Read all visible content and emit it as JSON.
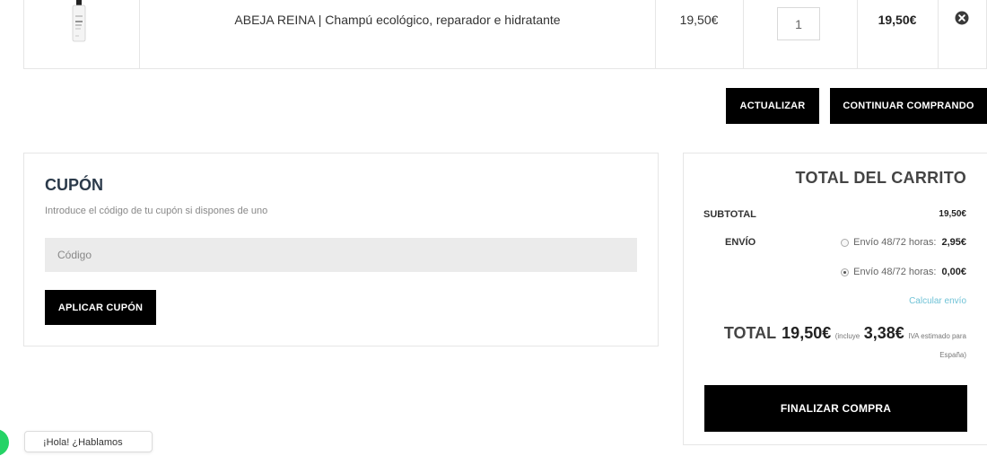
{
  "cart": {
    "item": {
      "name": "ABEJA REINA | Champú ecológico, reparador e hidratante",
      "price": "19,50€",
      "quantity": "1",
      "subtotal": "19,50€",
      "remove_icon": "remove-circle-x-icon"
    },
    "update_label": "ACTUALIZAR",
    "continue_label": "CONTINUAR COMPRANDO"
  },
  "coupon": {
    "title": "CUPÓN",
    "description": "Introduce el código de tu cupón si dispones de uno",
    "placeholder": "Código",
    "apply_label": "APLICAR CUPÓN"
  },
  "totals": {
    "title": "TOTAL DEL CARRITO",
    "subtotal_label": "SUBTOTAL",
    "subtotal_value": "19,50€",
    "shipping_label": "ENVÍO",
    "shipping_options": [
      {
        "label": "Envío 48/72 horas:",
        "price": "2,95€",
        "selected": false
      },
      {
        "label": "Envío 48/72 horas:",
        "price": "0,00€",
        "selected": true
      }
    ],
    "calc_shipping": "Calcular envío",
    "total_label": "TOTAL",
    "total_value": "19,50€",
    "includes_prefix": "(incluye",
    "iva_value": "3,38€",
    "iva_suffix": "IVA estimado para",
    "iva_country": "España)",
    "checkout_label": "FINALIZAR COMPRA"
  },
  "chat": {
    "label": "¡Hola! ¿Hablamos"
  },
  "colors": {
    "button_bg": "#000000",
    "link": "#6fc2d6",
    "chat_green": "#25d366",
    "input_bg": "#ebebeb"
  }
}
